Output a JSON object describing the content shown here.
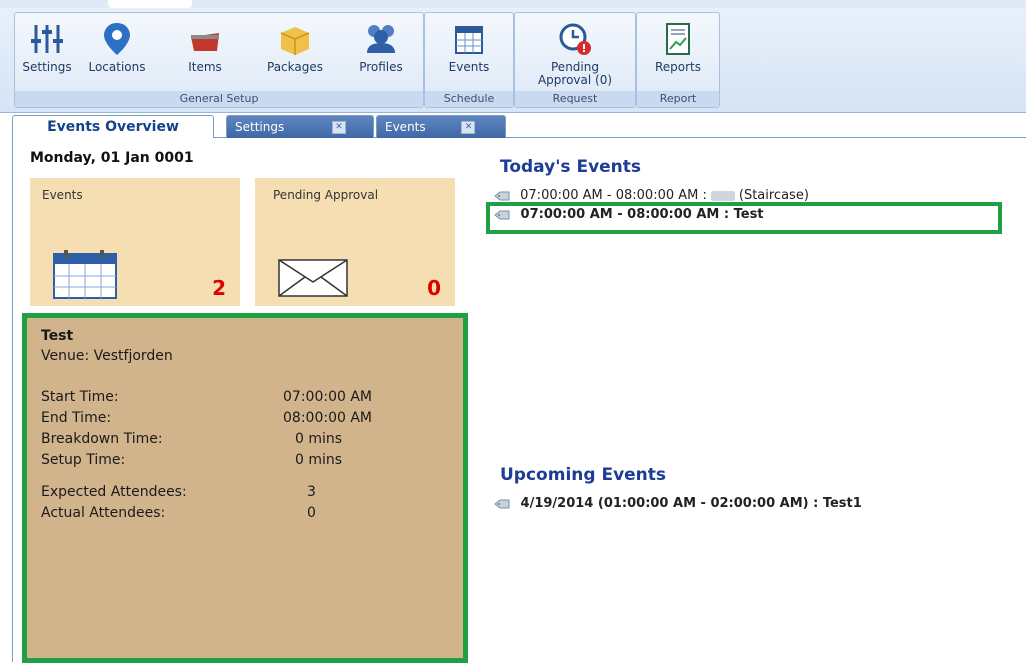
{
  "ribbon": {
    "groups": [
      {
        "label": "General Setup",
        "buttons": [
          "Settings",
          "Locations",
          "Items",
          "Packages",
          "Profiles"
        ]
      },
      {
        "label": "Schedule",
        "buttons": [
          "Events"
        ]
      },
      {
        "label": "Request",
        "buttons": [
          "Pending Approval (0)"
        ]
      },
      {
        "label": "Report",
        "buttons": [
          "Reports"
        ]
      }
    ]
  },
  "tabs": [
    {
      "label": "Events Overview",
      "active": true
    },
    {
      "label": "Settings",
      "active": false
    },
    {
      "label": "Events",
      "active": false
    }
  ],
  "overview": {
    "date": "Monday, 01 Jan 0001",
    "tiles": [
      {
        "title": "Events",
        "count": "2",
        "icon": "calendar-icon"
      },
      {
        "title": "Pending Approval",
        "count": "0",
        "icon": "envelope-icon"
      }
    ],
    "detail": {
      "title": "Test",
      "venue": "Venue: Vestfjorden",
      "rows": [
        {
          "label": "Start Time:",
          "value": "07:00:00 AM"
        },
        {
          "label": "End Time:",
          "value": "08:00:00 AM"
        },
        {
          "label": "Breakdown Time:",
          "value": "0 mins"
        },
        {
          "label": "Setup Time:",
          "value": "0 mins"
        },
        {
          "label": "Expected Attendees:",
          "value": "3"
        },
        {
          "label": "Actual Attendees:",
          "value": "0"
        }
      ]
    }
  },
  "today": {
    "heading": "Today's Events",
    "items": [
      {
        "pre": "07:00:00 AM - 08:00:00 AM :",
        "post": "(Staircase)"
      },
      {
        "text": "07:00:00 AM - 08:00:00 AM : Test"
      }
    ]
  },
  "upcoming": {
    "heading": "Upcoming Events",
    "items": [
      {
        "text": "4/19/2014 (01:00:00 AM - 02:00:00 AM) : Test1"
      }
    ]
  },
  "colors": {
    "accent": "#1c3c96",
    "highlight": "#1fa043",
    "count": "#e00000",
    "tile": "#f6deb3",
    "detail": "#d2b48c"
  }
}
